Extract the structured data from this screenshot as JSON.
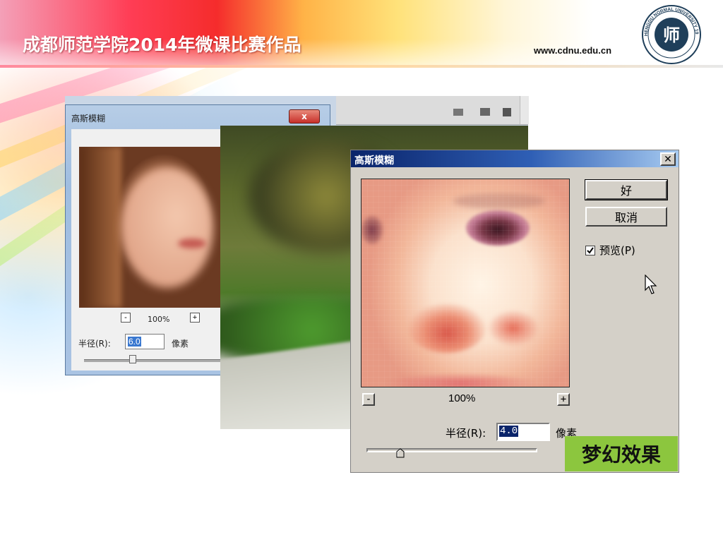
{
  "slide": {
    "title": "成都师范学院2014年微课比赛作品",
    "url": "www.cdnu.edu.cn",
    "logo_text": "CHENGDU NORMAL UNIVERSITY 1955",
    "caption": "梦幻效果"
  },
  "bg_dialog": {
    "title": "高斯模糊",
    "close_glyph": "x",
    "zoom_minus": "-",
    "zoom_plus": "+",
    "zoom_value": "100%",
    "radius_label": "半径(R):",
    "radius_value": "6.0",
    "unit": "像素"
  },
  "main_dialog": {
    "title": "高斯模糊",
    "close_glyph": "✕",
    "ok_label": "好",
    "cancel_label": "取消",
    "preview_checked": true,
    "preview_label": "预览(P)",
    "zoom_minus": "-",
    "zoom_plus": "+",
    "zoom_value": "100%",
    "radius_label": "半径(R):",
    "radius_value": "4.0",
    "unit": "像素",
    "slider_level": 0.2
  },
  "colors": {
    "caption_bg": "#8cc63e",
    "title_bar": "#0a246a",
    "dialog_face": "#d4d0c8"
  },
  "icons": [
    "checkmark-icon",
    "mouse-pointer-icon",
    "close-icon",
    "university-logo"
  ]
}
